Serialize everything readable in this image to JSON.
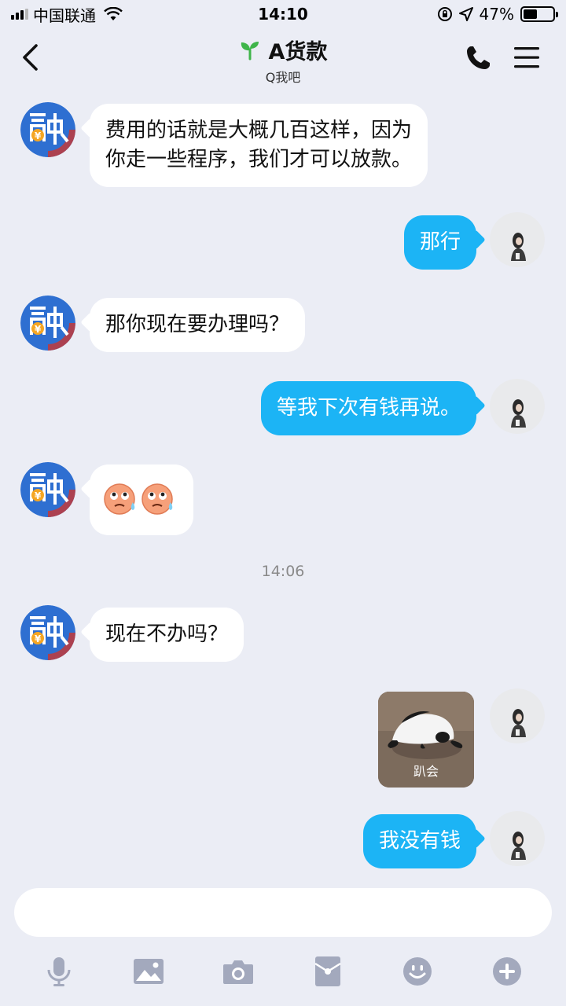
{
  "status_bar": {
    "carrier": "中国联通",
    "time": "14:10",
    "battery_percent": "47%",
    "battery_level": 0.47
  },
  "header": {
    "title": "A货款",
    "subtitle": "Q我吧",
    "icons": [
      "back-icon",
      "sprout-icon",
      "phone-icon",
      "menu-icon"
    ]
  },
  "messages": [
    {
      "from": "contact",
      "lines": [
        "费用的话就是大概几百这样，因为",
        "你走一些程序，我们才可以放款。"
      ]
    },
    {
      "from": "me",
      "text": "那行"
    },
    {
      "from": "contact",
      "text": "那你现在要办理吗？"
    },
    {
      "from": "me",
      "text": "等我下次有钱再说。"
    },
    {
      "from": "contact",
      "text": "🙄🙄",
      "emoji": [
        "sweating-face",
        "sweating-face"
      ]
    },
    {
      "from": "contact",
      "text": "现在不办吗？"
    },
    {
      "from": "me",
      "type": "sticker",
      "caption": "趴会"
    },
    {
      "from": "me",
      "text": "我没有钱"
    }
  ],
  "timestamp": "14:06",
  "input": {
    "placeholder": "",
    "value": ""
  },
  "toolbar": [
    "microphone-icon",
    "image-icon",
    "camera-icon",
    "red-packet-icon",
    "emoji-icon",
    "plus-icon"
  ],
  "colors": {
    "outgoing_bubble": "#1cb4f5",
    "incoming_bubble": "#ffffff",
    "background": "#ebedf5",
    "tool_icon": "#a3a9bd"
  }
}
